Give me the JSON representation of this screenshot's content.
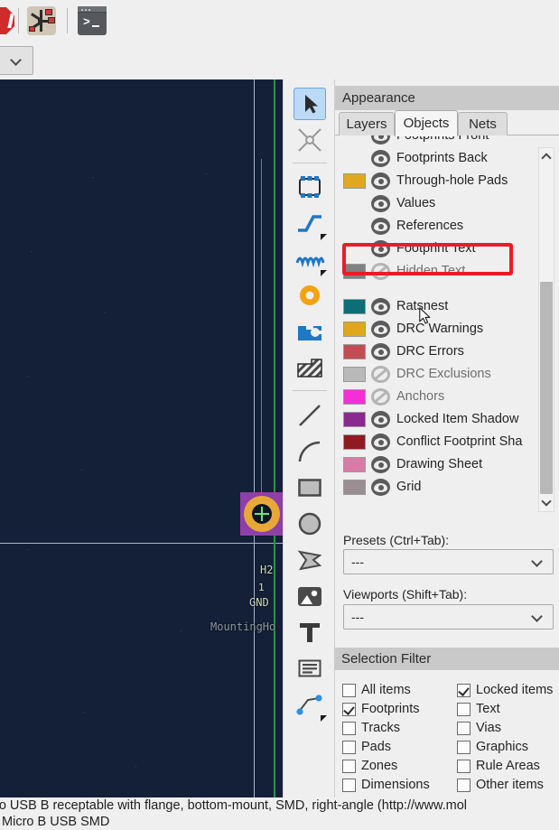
{
  "app": {
    "panel_title": "Appearance",
    "selection_filter_title": "Selection Filter"
  },
  "top_toolbar": {
    "icons": [
      {
        "name": "drc-icon",
        "label": "Design Rules Checker"
      },
      {
        "name": "net-inspector-icon",
        "label": "Net Inspector"
      },
      {
        "name": "scripting-console-icon",
        "label": "Scripting Console"
      }
    ],
    "units_dropdown_value": ""
  },
  "draw_toolbar": {
    "tools": [
      {
        "name": "select-tool",
        "label": "Select item(s)",
        "active": true
      },
      {
        "name": "highlight-net-tool",
        "label": "Highlight net",
        "active": false
      },
      {
        "name": "place-footprint-tool",
        "label": "Add a footprint",
        "active": false
      },
      {
        "name": "route-tracks-tool",
        "label": "Route tracks",
        "active": false
      },
      {
        "name": "route-diff-pair-tool",
        "label": "Route differential pair",
        "active": false
      },
      {
        "name": "add-via-tool",
        "label": "Add a free-standing via",
        "active": false
      },
      {
        "name": "draw-zone-tool",
        "label": "Draw a filled zone",
        "active": false
      },
      {
        "name": "draw-rule-area-tool",
        "label": "Draw a rule area",
        "active": false
      },
      {
        "name": "draw-line-tool",
        "label": "Draw a line",
        "active": false
      },
      {
        "name": "draw-arc-tool",
        "label": "Draw an arc",
        "active": false
      },
      {
        "name": "draw-rectangle-tool",
        "label": "Draw a rectangle",
        "active": false
      },
      {
        "name": "draw-circle-tool",
        "label": "Draw a circle",
        "active": false
      },
      {
        "name": "draw-polygon-tool",
        "label": "Draw a polygon",
        "active": false
      },
      {
        "name": "place-image-tool",
        "label": "Add a reference image",
        "active": false
      },
      {
        "name": "add-text-tool",
        "label": "Add a text item",
        "active": false
      },
      {
        "name": "add-textbox-tool",
        "label": "Add a text box",
        "active": false
      },
      {
        "name": "add-dimension-tool",
        "label": "Add a dimension",
        "active": false
      }
    ]
  },
  "appearance": {
    "tabs": [
      {
        "label": "Layers",
        "selected": false
      },
      {
        "label": "Objects",
        "selected": true
      },
      {
        "label": "Nets",
        "selected": false
      }
    ],
    "objects": [
      {
        "label": "Footprints Front",
        "swatch": null,
        "visible": true,
        "clipped": true
      },
      {
        "label": "Footprints Back",
        "swatch": null,
        "visible": true,
        "clipped": false
      },
      {
        "label": "Through-hole Pads",
        "swatch": "#e0a81f",
        "visible": true,
        "clipped": false
      },
      {
        "label": "Values",
        "swatch": null,
        "visible": true,
        "clipped": false
      },
      {
        "label": "References",
        "swatch": null,
        "visible": true,
        "clipped": false
      },
      {
        "label": "Footprint Text",
        "swatch": null,
        "visible": true,
        "clipped": false,
        "highlighted": true
      },
      {
        "label": "Hidden Text",
        "swatch": "#7f8184",
        "visible": false,
        "clipped": false
      },
      {
        "label": "",
        "swatch": null,
        "visible": null,
        "spacer": true
      },
      {
        "label": "Ratsnest",
        "swatch": "#0e6e77",
        "visible": true,
        "clipped": false
      },
      {
        "label": "DRC Warnings",
        "swatch": "#dfa81b",
        "visible": true,
        "clipped": false
      },
      {
        "label": "DRC Errors",
        "swatch": "#c14c52",
        "visible": true,
        "clipped": false
      },
      {
        "label": "DRC Exclusions",
        "swatch": "#b9b9b9",
        "visible": false,
        "clipped": false
      },
      {
        "label": "Anchors",
        "swatch": "#f42fd6",
        "visible": false,
        "clipped": false
      },
      {
        "label": "Locked Item Shadow",
        "swatch": "#8a2a8f",
        "visible": true,
        "clipped": false
      },
      {
        "label": "Conflict Footprint Sha",
        "swatch": "#8e1b22",
        "visible": true,
        "clipped": true
      },
      {
        "label": "Drawing Sheet",
        "swatch": "#d97ba6",
        "visible": true,
        "clipped": false
      },
      {
        "label": "Grid",
        "swatch": "#9a8e93",
        "visible": true,
        "clipped": false
      }
    ],
    "highlight_color": "#ec1c24",
    "presets_label": "Presets (Ctrl+Tab):",
    "presets_value": "---",
    "viewports_label": "Viewports (Shift+Tab):",
    "viewports_value": "---"
  },
  "selection_filter": {
    "left_column": [
      {
        "label": "All items",
        "checked": false
      },
      {
        "label": "Footprints",
        "checked": true
      },
      {
        "label": "Tracks",
        "checked": false
      },
      {
        "label": "Pads",
        "checked": false
      },
      {
        "label": "Zones",
        "checked": false
      },
      {
        "label": "Dimensions",
        "checked": false
      }
    ],
    "right_column": [
      {
        "label": "Locked items",
        "checked": true
      },
      {
        "label": "Text",
        "checked": false
      },
      {
        "label": "Vias",
        "checked": false
      },
      {
        "label": "Graphics",
        "checked": false
      },
      {
        "label": "Rule Areas",
        "checked": false
      },
      {
        "label": "Other items",
        "checked": false
      }
    ]
  },
  "canvas": {
    "background_color": "#132038",
    "board_edge_color": "#1f9b3f",
    "crosshair_color": "#a9b4c4",
    "footprint": {
      "reference": "H2",
      "pad_number": "1",
      "net_name": "GND",
      "value": "MountingHo",
      "pad_color": "#e8a838",
      "courtyard_color": "#8f3fa8"
    }
  },
  "statusbar": {
    "line1": "ro USB B receptable with flange, bottom-mount, SMD, right-angle (http://www.mol",
    "line2": ": Micro B USB SMD"
  }
}
